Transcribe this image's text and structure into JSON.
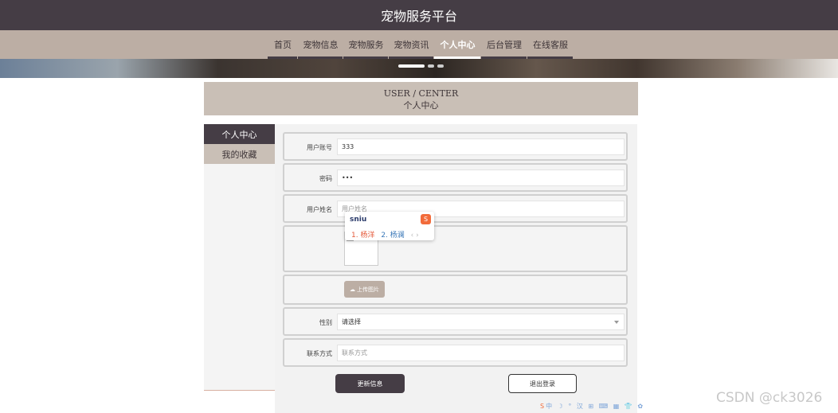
{
  "site_title": "宠物服务平台",
  "nav": [
    {
      "label": "首页",
      "active": false
    },
    {
      "label": "宠物信息",
      "active": false
    },
    {
      "label": "宠物服务",
      "active": false
    },
    {
      "label": "宠物资讯",
      "active": false
    },
    {
      "label": "个人中心",
      "active": true
    },
    {
      "label": "后台管理",
      "active": false
    },
    {
      "label": "在线客服",
      "active": false
    }
  ],
  "header": {
    "en": "USER / CENTER",
    "zh": "个人中心"
  },
  "sidebar": [
    {
      "label": "个人中心",
      "active": true
    },
    {
      "label": "我的收藏",
      "active": false
    }
  ],
  "form": {
    "account": {
      "label": "用户账号",
      "value": "333"
    },
    "password": {
      "label": "密码",
      "value": "•••"
    },
    "name": {
      "label": "用户姓名",
      "placeholder": "用户姓名"
    },
    "upload_label": "上传图片",
    "gender": {
      "label": "性别",
      "value": "请选择"
    },
    "contact": {
      "label": "联系方式",
      "placeholder": "联系方式"
    }
  },
  "buttons": {
    "update": "更新信息",
    "logout": "退出登录"
  },
  "ime": {
    "input": "sniu",
    "cand1": "1. 杨洋",
    "cand2": "2. 杨澜",
    "arrows": "‹ ›",
    "logo": "S"
  },
  "ime_toolbar": "中 ☽ ° 汉 ⊞ ⌨ ▦ 👕 ✿",
  "watermark": "CSDN @ck3026",
  "colors": {
    "primary_dark": "#453d45",
    "nav_tan": "#bcaea4",
    "header_tan": "#c9bfb6"
  }
}
